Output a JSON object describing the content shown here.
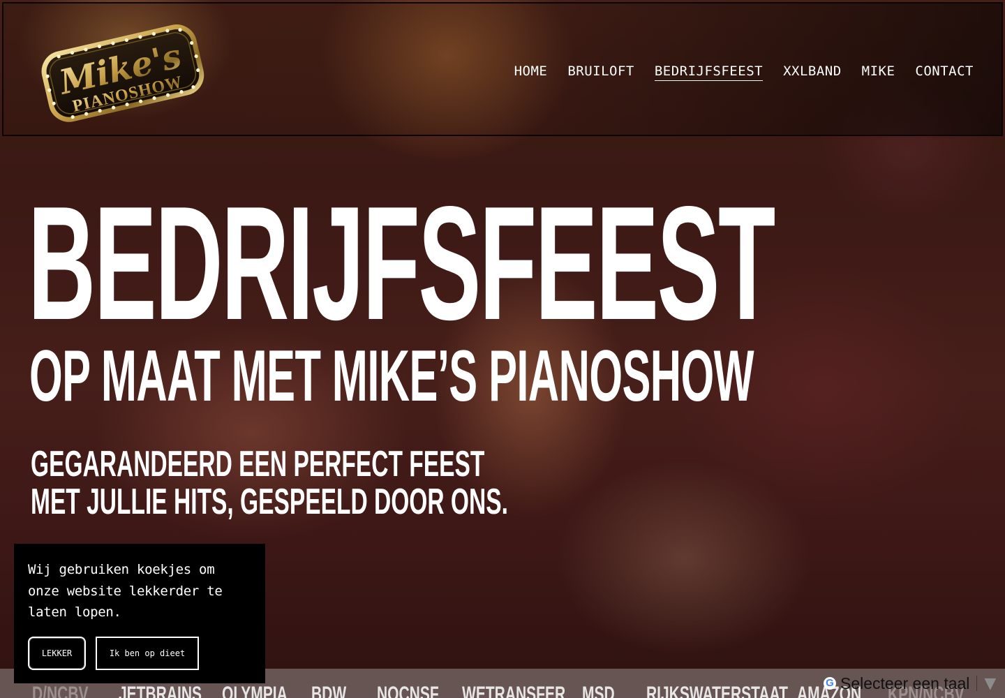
{
  "brand": {
    "logo_script": "Mike's",
    "logo_word": "PIANOSHOW",
    "colors": {
      "gold": "#c9a24a",
      "gold_light": "#f3d98a",
      "dark": "#1a1208"
    }
  },
  "nav": {
    "items": [
      {
        "label": "HOME",
        "active": false
      },
      {
        "label": "BRUILOFT",
        "active": false
      },
      {
        "label": "BEDRIJFSFEEST",
        "active": true
      },
      {
        "label": "XXLBAND",
        "active": false
      },
      {
        "label": "MIKE",
        "active": false
      },
      {
        "label": "CONTACT",
        "active": false
      }
    ]
  },
  "hero": {
    "title": "BEDRIJFSFEEST",
    "subtitle": "OP MAAT MET MIKE’S PIANOSHOW",
    "tagline_line1": "GEGARANDEERD EEN PERFECT FEEST",
    "tagline_line2": "MET JULLIE HITS, GESPEELD DOOR ONS."
  },
  "clients": [
    "D/NCBV",
    "JETBRAINS",
    "OLYMPIA",
    "BDW",
    "NOCNSF",
    "WETRANSFER",
    "MSD",
    "RIJKSWATERSTAAT",
    "AMAZON",
    "KPN/NCBV"
  ],
  "translate": {
    "icon": "google-g-icon",
    "label": "Selecteer een taal",
    "arrow": "▼"
  },
  "cookie": {
    "text": "Wij gebruiken koekjes om onze website lekkerder te laten lopen.",
    "accept_label": "LEKKER",
    "decline_label": "Ik ben op dieet"
  }
}
